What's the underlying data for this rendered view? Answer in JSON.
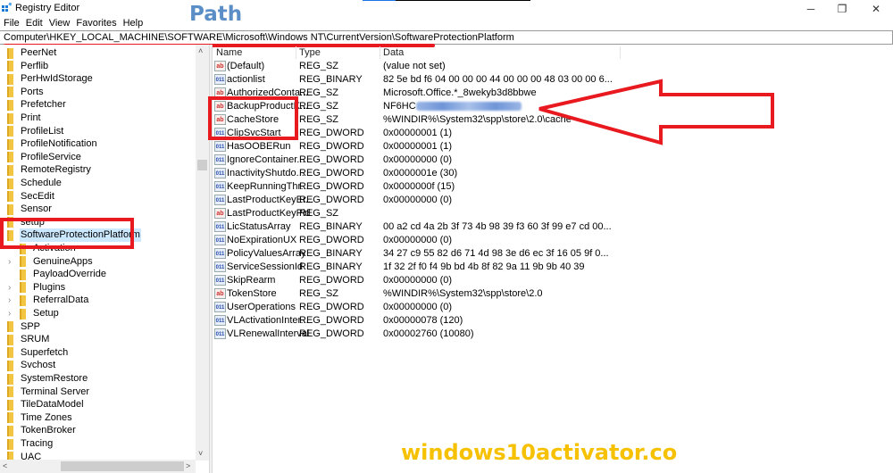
{
  "window": {
    "title": "Registry Editor",
    "controls": {
      "minimize": "─",
      "restore": "❐",
      "close": "✕"
    }
  },
  "menu": [
    "File",
    "Edit",
    "View",
    "Favorites",
    "Help"
  ],
  "annotation": {
    "path_label": "Path",
    "watermark": "windows10activator.co",
    "highlight_color": "#e8191f"
  },
  "address": "Computer\\HKEY_LOCAL_MACHINE\\SOFTWARE\\Microsoft\\Windows NT\\CurrentVersion\\SoftwareProtectionPlatform",
  "tree": {
    "items": [
      {
        "label": "PeerNet",
        "level": 0
      },
      {
        "label": "Perflib",
        "level": 0
      },
      {
        "label": "PerHwIdStorage",
        "level": 0
      },
      {
        "label": "Ports",
        "level": 0
      },
      {
        "label": "Prefetcher",
        "level": 0
      },
      {
        "label": "Print",
        "level": 0
      },
      {
        "label": "ProfileList",
        "level": 0
      },
      {
        "label": "ProfileNotification",
        "level": 0
      },
      {
        "label": "ProfileService",
        "level": 0
      },
      {
        "label": "RemoteRegistry",
        "level": 0
      },
      {
        "label": "Schedule",
        "level": 0
      },
      {
        "label": "SecEdit",
        "level": 0
      },
      {
        "label": "Sensor",
        "level": 0
      },
      {
        "label": "setup",
        "level": 0
      },
      {
        "label": "SoftwareProtectionPlatform",
        "level": 0,
        "selected": true
      },
      {
        "label": "Activation",
        "level": 1
      },
      {
        "label": "GenuineApps",
        "level": 1,
        "expandable": true
      },
      {
        "label": "PayloadOverride",
        "level": 1
      },
      {
        "label": "Plugins",
        "level": 1,
        "expandable": true
      },
      {
        "label": "ReferralData",
        "level": 1,
        "expandable": true
      },
      {
        "label": "Setup",
        "level": 1,
        "expandable": true
      },
      {
        "label": "SPP",
        "level": 0
      },
      {
        "label": "SRUM",
        "level": 0
      },
      {
        "label": "Superfetch",
        "level": 0
      },
      {
        "label": "Svchost",
        "level": 0
      },
      {
        "label": "SystemRestore",
        "level": 0
      },
      {
        "label": "Terminal Server",
        "level": 0
      },
      {
        "label": "TileDataModel",
        "level": 0
      },
      {
        "label": "Time Zones",
        "level": 0
      },
      {
        "label": "TokenBroker",
        "level": 0
      },
      {
        "label": "Tracing",
        "level": 0
      },
      {
        "label": "UAC",
        "level": 0
      }
    ]
  },
  "list": {
    "columns": [
      "Name",
      "Type",
      "Data"
    ],
    "rows": [
      {
        "name": "(Default)",
        "type": "REG_SZ",
        "data": "(value not set)",
        "icon": "sz"
      },
      {
        "name": "actionlist",
        "type": "REG_BINARY",
        "data": "82 5e bd f6 04 00 00 00 44 00 00 00 48 03 00 00 6...",
        "icon": "bin"
      },
      {
        "name": "AuthorizedConta...",
        "type": "REG_SZ",
        "data": "Microsoft.Office.*_8wekyb3d8bbwe",
        "icon": "sz"
      },
      {
        "name": "BackupProductK...",
        "type": "REG_SZ",
        "data": "NF6HC",
        "icon": "sz",
        "redacted": true
      },
      {
        "name": "CacheStore",
        "type": "REG_SZ",
        "data": "%WINDIR%\\System32\\spp\\store\\2.0\\cache",
        "icon": "sz"
      },
      {
        "name": "ClipSvcStart",
        "type": "REG_DWORD",
        "data": "0x00000001 (1)",
        "icon": "bin"
      },
      {
        "name": "HasOOBERun",
        "type": "REG_DWORD",
        "data": "0x00000001 (1)",
        "icon": "bin"
      },
      {
        "name": "IgnoreContainer...",
        "type": "REG_DWORD",
        "data": "0x00000000 (0)",
        "icon": "bin"
      },
      {
        "name": "InactivityShutdo...",
        "type": "REG_DWORD",
        "data": "0x0000001e (30)",
        "icon": "bin"
      },
      {
        "name": "KeepRunningThr...",
        "type": "REG_DWORD",
        "data": "0x0000000f (15)",
        "icon": "bin"
      },
      {
        "name": "LastProductKeyEr...",
        "type": "REG_DWORD",
        "data": "0x00000000 (0)",
        "icon": "bin"
      },
      {
        "name": "LastProductKeyPid",
        "type": "REG_SZ",
        "data": "",
        "icon": "sz"
      },
      {
        "name": "LicStatusArray",
        "type": "REG_BINARY",
        "data": "00 a2 cd 4a 2b 3f 73 4b 98 39 f3 60 3f 99 e7 cd 00...",
        "icon": "bin"
      },
      {
        "name": "NoExpirationUX",
        "type": "REG_DWORD",
        "data": "0x00000000 (0)",
        "icon": "bin"
      },
      {
        "name": "PolicyValuesArray",
        "type": "REG_BINARY",
        "data": "34 27 c9 55 82 d6 71 4d 98 3e d6 ec 3f 16 05 9f 0...",
        "icon": "bin"
      },
      {
        "name": "ServiceSessionId",
        "type": "REG_BINARY",
        "data": "1f 32 2f f0 f4 9b bd 4b 8f 82 9a 11 9b 9b 40 39",
        "icon": "bin"
      },
      {
        "name": "SkipRearm",
        "type": "REG_DWORD",
        "data": "0x00000000 (0)",
        "icon": "bin"
      },
      {
        "name": "TokenStore",
        "type": "REG_SZ",
        "data": "%WINDIR%\\System32\\spp\\store\\2.0",
        "icon": "sz"
      },
      {
        "name": "UserOperations",
        "type": "REG_DWORD",
        "data": "0x00000000 (0)",
        "icon": "bin"
      },
      {
        "name": "VLActivationInter...",
        "type": "REG_DWORD",
        "data": "0x00000078 (120)",
        "icon": "bin"
      },
      {
        "name": "VLRenewalInterval",
        "type": "REG_DWORD",
        "data": "0x00002760 (10080)",
        "icon": "bin"
      }
    ]
  },
  "scrollbars": {
    "tree_vertical_position": 0.28,
    "tree_horizontal_position": 0.33
  }
}
